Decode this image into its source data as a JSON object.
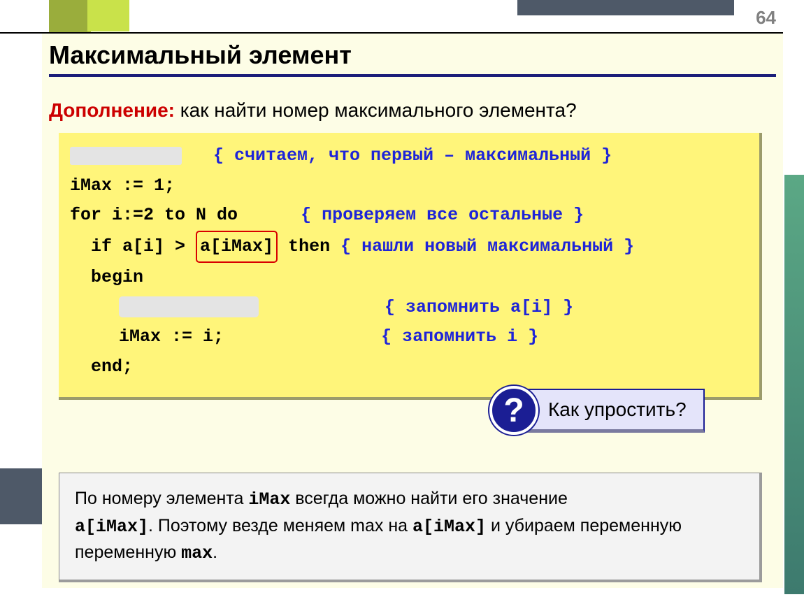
{
  "page_number": "64",
  "title": "Максимальный элемент",
  "subtitle_lead": "Дополнение:",
  "subtitle_rest": " как найти номер максимального элемента?",
  "code": {
    "c1": "{ считаем, что первый – максимальный }",
    "l2": "iMax := 1;",
    "l3a": "for i:=2 to N do",
    "c3": "{ проверяем все остальные }",
    "l4a": "if a[i] > ",
    "l4box": "a[iMax]",
    "l4b": " then ",
    "c4": "{ нашли новый максимальный }",
    "l5": "begin",
    "c6": "{ запомнить a[i] }",
    "l7": "iMax := i;",
    "c7": "{ запомнить i }",
    "l8": "end;"
  },
  "callout": {
    "mark": "?",
    "text": "Как упростить?"
  },
  "explanation": {
    "p1a": "По номеру элемента ",
    "p1m1": "iMax",
    "p1b": " всегда можно найти его значение ",
    "p2m1": "a[iMax]",
    "p2a": ". Поэтому везде меняем max на ",
    "p2m2": "a[iMax]",
    "p2b": " и убираем переменную ",
    "p2m3": "max",
    "p2c": "."
  }
}
